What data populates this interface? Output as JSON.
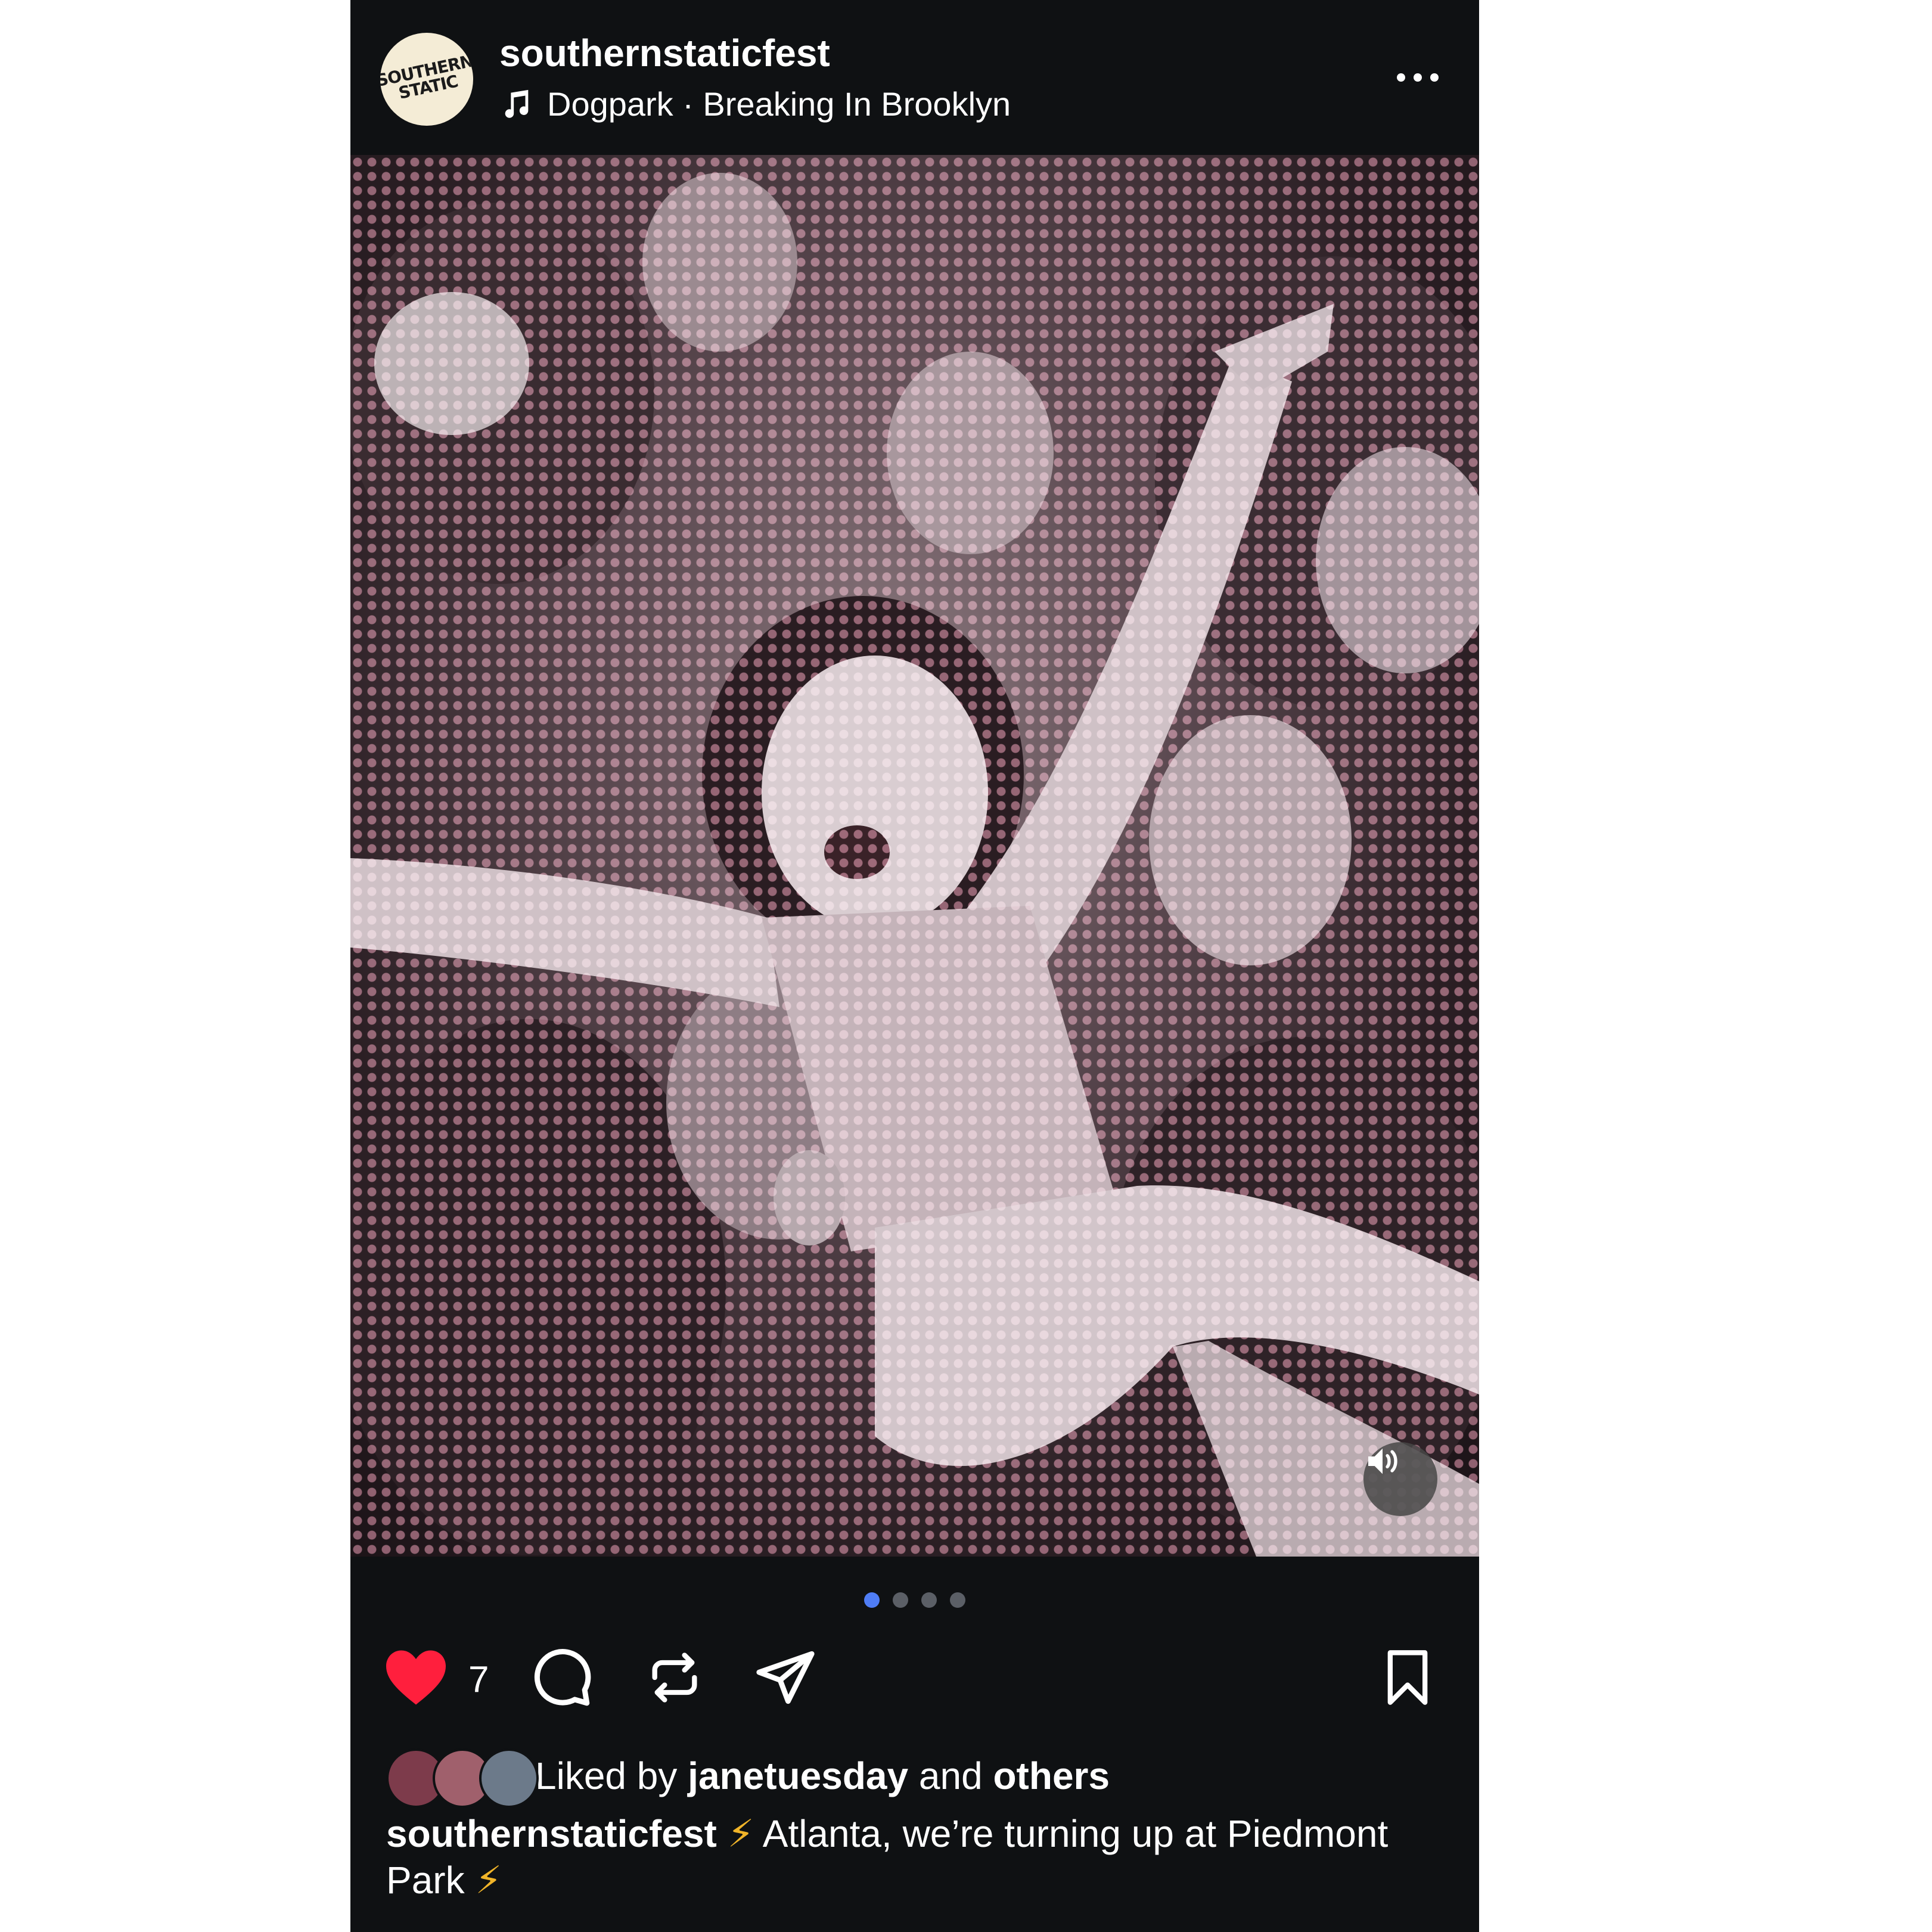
{
  "header": {
    "username": "southernstaticfest",
    "avatar_logo": [
      "SOUTHERN",
      "STATIC"
    ],
    "music_track": "Dogpark · Breaking In Brooklyn",
    "music_icon": "music-note-icon",
    "more_icon": "more-horizontal-icon"
  },
  "media": {
    "description_icon": "volume-icon",
    "carousel": {
      "total": 4,
      "active_index": 0
    }
  },
  "actions": {
    "like_count": "7",
    "like_icon": "heart-filled-icon",
    "comment_icon": "comment-icon",
    "repost_icon": "repost-icon",
    "share_icon": "send-icon",
    "save_icon": "bookmark-icon"
  },
  "likes": {
    "prefix": "Liked by ",
    "user": "janetuesday",
    "middle": " and ",
    "others": "others"
  },
  "caption": {
    "username": "southernstaticfest",
    "bolt": "⚡",
    "text1": " Atlanta, we’re turning up at Piedmont Park ",
    "bolt2": "⚡"
  },
  "colors": {
    "background": "#0f1113",
    "heart": "#ff1f3d",
    "carousel_active": "#4f7df5",
    "halftone": "#eb96af"
  }
}
